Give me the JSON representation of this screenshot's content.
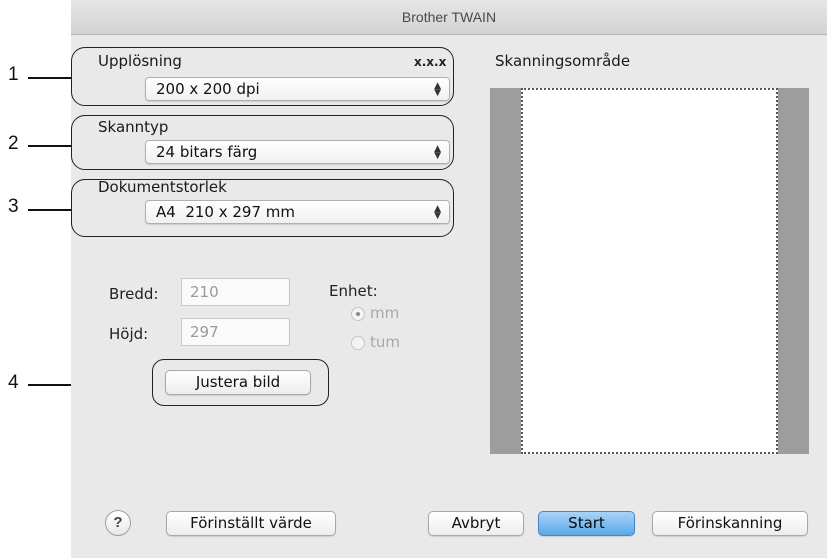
{
  "window": {
    "title": "Brother TWAIN"
  },
  "callouts": [
    "1",
    "2",
    "3",
    "4"
  ],
  "resolution": {
    "label": "Upplösning",
    "version": "x.x.x",
    "value": "200 x 200 dpi"
  },
  "scan_type": {
    "label": "Skanntyp",
    "value": "24 bitars färg"
  },
  "document_size": {
    "label": "Dokumentstorlek",
    "value": "A4  210 x 297 mm"
  },
  "dimensions": {
    "width_label": "Bredd:",
    "width_value": "210",
    "height_label": "Höjd:",
    "height_value": "297",
    "unit_label": "Enhet:",
    "units": [
      {
        "label": "mm",
        "selected": true
      },
      {
        "label": "tum",
        "selected": false
      }
    ]
  },
  "adjust_button": "Justera bild",
  "scan_area": {
    "label": "Skanningsområde"
  },
  "footer": {
    "help": "?",
    "default_button": "Förinställt värde",
    "cancel_button": "Avbryt",
    "start_button": "Start",
    "prescan_button": "Förinskanning"
  },
  "colors": {
    "accent": "#5aa8ea",
    "window_bg": "#e9e9e9",
    "scan_bg": "#9d9d9d"
  }
}
